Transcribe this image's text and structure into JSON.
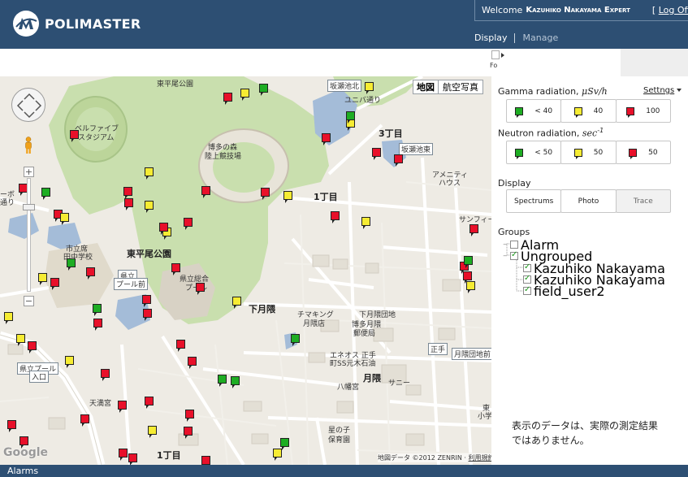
{
  "header": {
    "logo_text": "POLIMASTER",
    "welcome_label": "Welcome",
    "user_name": "Kazuhiko Nakayama Expert",
    "logoff_open": "[",
    "logoff_label": "Log Off",
    "logoff_close": "]",
    "nav": [
      {
        "label": "Display"
      },
      {
        "label": "Manage"
      }
    ]
  },
  "map": {
    "map_type_map": "地図",
    "map_type_satellite": "航空写真",
    "google_logo": "Google",
    "copyright_text": "地図データ ©2012 ZENRIN ·",
    "terms_label": "利用規約",
    "labels": [
      "東平尾公園",
      "坂瀬池北",
      "ユニバ通り",
      "3丁目",
      "坂瀬池東",
      "アメニティ",
      "ハウス",
      "1丁目",
      "東平尾公園",
      "サンフィー",
      "ベルファイブ",
      "スタジアム",
      "博多の森",
      "陸上競技場",
      "市立席",
      "田中学校",
      "県立",
      "プール前",
      "県立総合",
      "プール",
      "下月隈",
      "チマキング",
      "月隈店",
      "下月隈団地",
      "博多月隈",
      "郵便局",
      "エネオス 正手",
      "町SS元木石油",
      "正手",
      "月隈団地前",
      "月隈",
      "八幡宮",
      "サニー",
      "県立プール",
      "入口",
      "天満宮",
      "星の子",
      "保育園",
      "1丁目",
      "ーボ",
      "通り",
      "東",
      "小学"
    ]
  },
  "markers": [
    {
      "color": "red"
    },
    {
      "color": "yellow"
    },
    {
      "color": "green"
    },
    {
      "color": "yellow"
    },
    {
      "color": "red"
    },
    {
      "color": "yellow"
    },
    {
      "color": "green"
    },
    {
      "color": "red"
    },
    {
      "color": "red"
    },
    {
      "color": "red"
    },
    {
      "color": "yellow"
    },
    {
      "color": "red"
    },
    {
      "color": "red"
    },
    {
      "color": "yellow"
    },
    {
      "color": "red"
    },
    {
      "color": "green"
    },
    {
      "color": "red"
    },
    {
      "color": "red"
    },
    {
      "color": "yellow"
    },
    {
      "color": "red"
    },
    {
      "color": "yellow"
    },
    {
      "color": "red"
    },
    {
      "color": "red"
    },
    {
      "color": "yellow"
    },
    {
      "color": "yellow"
    },
    {
      "color": "red"
    },
    {
      "color": "green"
    },
    {
      "color": "red"
    },
    {
      "color": "red"
    },
    {
      "color": "yellow"
    },
    {
      "color": "red"
    },
    {
      "color": "yellow"
    },
    {
      "color": "red"
    },
    {
      "color": "red"
    },
    {
      "color": "yellow"
    },
    {
      "color": "green"
    },
    {
      "color": "red"
    },
    {
      "color": "red"
    },
    {
      "color": "red"
    },
    {
      "color": "green"
    },
    {
      "color": "red"
    },
    {
      "color": "yellow"
    },
    {
      "color": "red"
    },
    {
      "color": "red"
    },
    {
      "color": "yellow"
    },
    {
      "color": "red"
    },
    {
      "color": "red"
    },
    {
      "color": "yellow"
    },
    {
      "color": "red"
    },
    {
      "color": "green"
    },
    {
      "color": "green"
    },
    {
      "color": "red"
    },
    {
      "color": "red"
    },
    {
      "color": "red"
    },
    {
      "color": "red"
    },
    {
      "color": "red"
    },
    {
      "color": "yellow"
    },
    {
      "color": "green"
    },
    {
      "color": "red"
    },
    {
      "color": "red"
    },
    {
      "color": "red"
    },
    {
      "color": "yellow"
    },
    {
      "color": "red"
    },
    {
      "color": "green"
    },
    {
      "color": "red"
    }
  ],
  "panel": {
    "toggle_label": "Fo",
    "gamma": {
      "title_prefix": "Gamma radiation, ",
      "unit": "μSv/h",
      "settings_label": "Settngs",
      "buttons": [
        {
          "color": "green",
          "label": "< 40"
        },
        {
          "color": "yellow",
          "label": "40"
        },
        {
          "color": "red",
          "label": "100"
        }
      ]
    },
    "neutron": {
      "title_prefix": "Neutron radiation, ",
      "unit": "sec",
      "unit_exp": "-1",
      "buttons": [
        {
          "color": "green",
          "label": "< 50"
        },
        {
          "color": "yellow",
          "label": "50"
        },
        {
          "color": "red",
          "label": "50"
        }
      ]
    },
    "display": {
      "title": "Display",
      "buttons": [
        {
          "label": "Spectrums"
        },
        {
          "label": "Photo"
        },
        {
          "label": "Trace"
        }
      ]
    },
    "groups": {
      "title": "Groups",
      "items": [
        {
          "label": "Alarm",
          "checked": false
        },
        {
          "label": "Ungrouped",
          "checked": true
        },
        {
          "label": "Kazuhiko Nakayama",
          "checked": true
        },
        {
          "label": "Kazuhiko Nakayama",
          "checked": true
        },
        {
          "label": "field_user2",
          "checked": true
        }
      ]
    },
    "notice_line1": "表示のデータは、実際の測定結果",
    "notice_line2": "ではありません。"
  },
  "footer": {
    "alarms_label": "Alarms"
  },
  "colors": {
    "header_bg": "#2d4f73",
    "marker_red": "#e8102a",
    "marker_yellow": "#f6ec33",
    "marker_green": "#1ead23",
    "park_green": "#c9dfae",
    "water_blue": "#a4bcd8"
  }
}
